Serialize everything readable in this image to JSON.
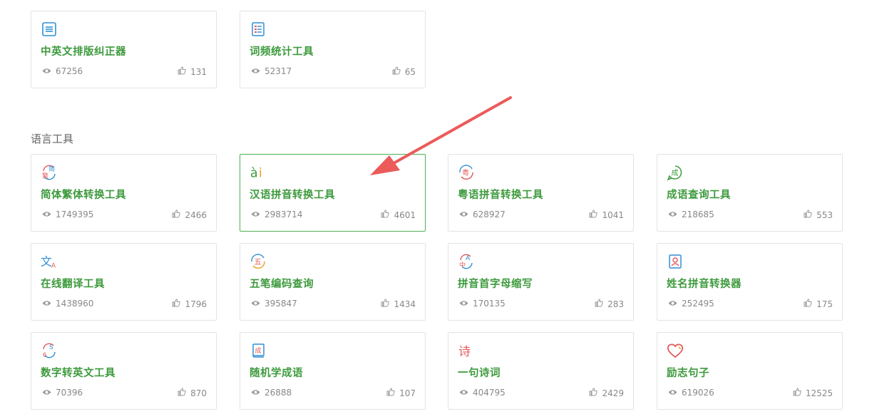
{
  "colors": {
    "accent": "#3d9a3d",
    "border": "#e3e3e3",
    "active_border": "#4caf50",
    "arrow": "#ec5a5a"
  },
  "top_tools": [
    {
      "name": "中英文排版纠正器",
      "views": "67256",
      "likes": "131",
      "icon": "text-align-icon"
    },
    {
      "name": "词频统计工具",
      "views": "52317",
      "likes": "65",
      "icon": "list-icon"
    }
  ],
  "section": {
    "title": "语言工具"
  },
  "language_tools": [
    {
      "name": "简体繁体转换工具",
      "views": "1749395",
      "likes": "2466",
      "icon": "simplified-traditional-icon",
      "glyph_a": "简",
      "glyph_b": "繁"
    },
    {
      "name": "汉语拼音转换工具",
      "views": "2983714",
      "likes": "4601",
      "icon": "pinyin-icon",
      "glyph_a": "ài"
    },
    {
      "name": "粤语拼音转换工具",
      "views": "628927",
      "likes": "1041",
      "icon": "cantonese-icon",
      "glyph_a": "粤"
    },
    {
      "name": "成语查询工具",
      "views": "218685",
      "likes": "553",
      "icon": "idiom-icon",
      "glyph_a": "成"
    },
    {
      "name": "在线翻译工具",
      "views": "1438960",
      "likes": "1796",
      "icon": "translate-icon",
      "glyph_a": "文",
      "glyph_b": "A"
    },
    {
      "name": "五笔编码查询",
      "views": "395847",
      "likes": "1434",
      "icon": "wubi-icon",
      "glyph_a": "五"
    },
    {
      "name": "拼音首字母缩写",
      "views": "170135",
      "likes": "283",
      "icon": "initials-icon",
      "glyph_a": "A",
      "glyph_b": "中"
    },
    {
      "name": "姓名拼音转换器",
      "views": "252495",
      "likes": "175",
      "icon": "name-card-icon"
    },
    {
      "name": "数字转英文工具",
      "views": "70396",
      "likes": "870",
      "icon": "number-english-icon",
      "glyph_a": "S",
      "glyph_b": "6"
    },
    {
      "name": "随机学成语",
      "views": "26888",
      "likes": "107",
      "icon": "idiom-book-icon",
      "glyph_a": "成"
    },
    {
      "name": "一句诗词",
      "views": "404795",
      "likes": "2429",
      "icon": "poem-icon",
      "glyph_a": "诗"
    },
    {
      "name": "励志句子",
      "views": "619026",
      "likes": "12525",
      "icon": "heart-icon"
    }
  ]
}
